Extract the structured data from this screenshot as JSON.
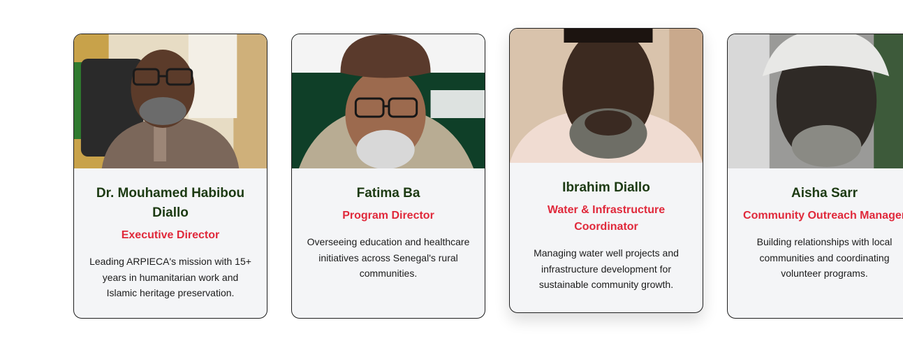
{
  "team": {
    "members": [
      {
        "name": "Dr. Mouhamed Habibou Diallo",
        "role": "Executive Director",
        "description": "Leading ARPIECA's mission with 15+ years in humanitarian work and Islamic heritage preservation."
      },
      {
        "name": "Fatima Ba",
        "role": "Program Director",
        "description": "Overseeing education and healthcare initiatives across Senegal's rural communities."
      },
      {
        "name": "Ibrahim Diallo",
        "role": "Water & Infrastructure Coordinator",
        "description": "Managing water well projects and infrastructure development for sustainable community growth."
      },
      {
        "name": "Aisha Sarr",
        "role": "Community Outreach Manager",
        "description": "Building relationships with local communities and coordinating volunteer programs."
      }
    ]
  },
  "colors": {
    "name_text": "#1c3a12",
    "role_text": "#e0293b",
    "card_background": "#f4f5f7",
    "card_border": "#1f1f1f"
  }
}
